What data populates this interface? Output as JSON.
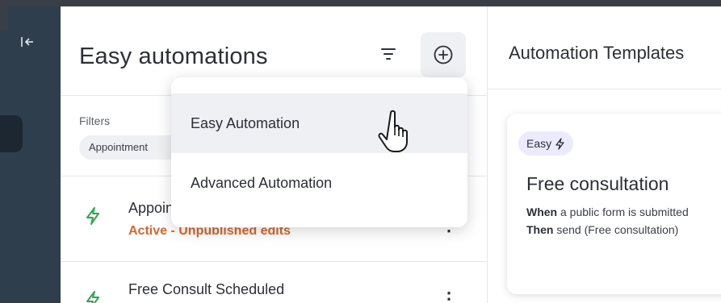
{
  "nav": {
    "collapse_icon": "collapse-left-icon"
  },
  "list": {
    "title": "Easy automations",
    "filter_icon": "filter-icon",
    "add_icon": "plus-circle-icon",
    "filters_label": "Filters",
    "filter_chip": "Appointment",
    "rows": [
      {
        "title": "Appointment Reminder",
        "status": "Active - Unpublished edits",
        "more": "⋮",
        "icon": "bolt-icon"
      },
      {
        "title": "Free Consult Scheduled",
        "status": "",
        "more": "⋮",
        "icon": "bolt-icon"
      }
    ]
  },
  "dropdown": {
    "items": [
      {
        "label": "Easy Automation",
        "active": true
      },
      {
        "label": "Advanced Automation",
        "active": false
      }
    ]
  },
  "templates": {
    "title": "Automation Templates",
    "card": {
      "badge": "Easy",
      "title": "Free consultation",
      "when_label": "When",
      "when_text": " a public form is submitted",
      "then_label": "Then",
      "then_text": " send (Free consultation)"
    }
  },
  "colors": {
    "nav_bg": "#2e3e4c",
    "success_green": "#2fa84f",
    "warning_orange": "#e0642a",
    "badge_bg": "#eceaff"
  }
}
